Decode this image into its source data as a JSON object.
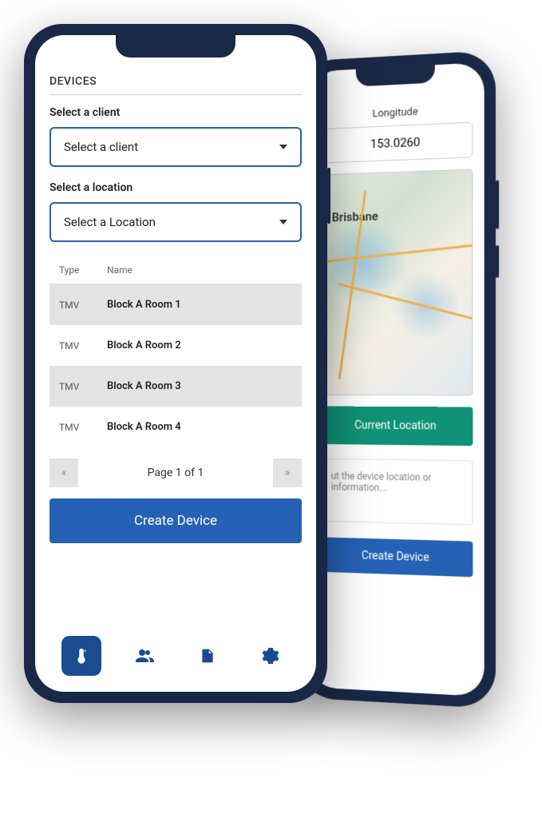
{
  "front": {
    "section_title": "DEVICES",
    "client_label": "Select a client",
    "client_placeholder": "Select a client",
    "location_label": "Select a location",
    "location_placeholder": "Select a Location",
    "table": {
      "headers": {
        "type": "Type",
        "name": "Name"
      },
      "rows": [
        {
          "type": "TMV",
          "name": "Block A Room 1"
        },
        {
          "type": "TMV",
          "name": "Block A Room 2"
        },
        {
          "type": "TMV",
          "name": "Block A Room 3"
        },
        {
          "type": "TMV",
          "name": "Block A Room 4"
        }
      ]
    },
    "pagination": {
      "prev": "«",
      "text": "Page 1 of 1",
      "next": "»"
    },
    "create_btn": "Create Device"
  },
  "back": {
    "longitude_label": "Longitude",
    "longitude_value": "153.0260",
    "map_city": "Brisbane",
    "location_btn": "Current Location",
    "notes_placeholder": "ut the device location or information...",
    "create_btn": "Create Device"
  },
  "colors": {
    "primary": "#2562b5",
    "teal": "#0f9275",
    "phone": "#1a2847"
  }
}
